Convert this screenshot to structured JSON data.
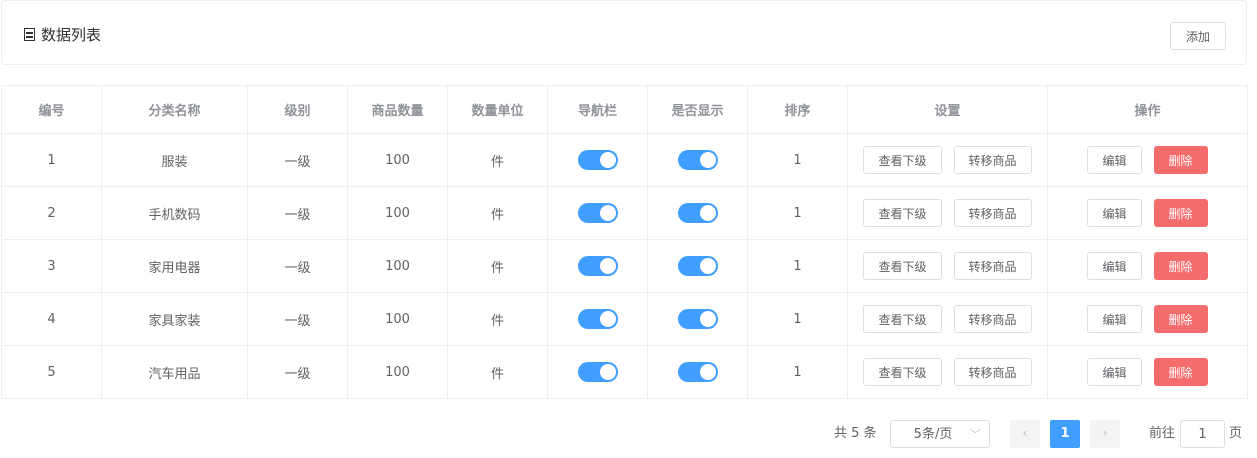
{
  "header": {
    "title": "数据列表",
    "add_label": "添加"
  },
  "table": {
    "columns": [
      "编号",
      "分类名称",
      "级别",
      "商品数量",
      "数量单位",
      "导航栏",
      "是否显示",
      "排序",
      "设置",
      "操作"
    ],
    "rows": [
      {
        "id": "1",
        "name": "服装",
        "level": "一级",
        "count": "100",
        "unit": "件",
        "nav": true,
        "show": true,
        "sort": "1"
      },
      {
        "id": "2",
        "name": "手机数码",
        "level": "一级",
        "count": "100",
        "unit": "件",
        "nav": true,
        "show": true,
        "sort": "1"
      },
      {
        "id": "3",
        "name": "家用电器",
        "level": "一级",
        "count": "100",
        "unit": "件",
        "nav": true,
        "show": true,
        "sort": "1"
      },
      {
        "id": "4",
        "name": "家具家装",
        "level": "一级",
        "count": "100",
        "unit": "件",
        "nav": true,
        "show": true,
        "sort": "1"
      },
      {
        "id": "5",
        "name": "汽车用品",
        "level": "一级",
        "count": "100",
        "unit": "件",
        "nav": true,
        "show": true,
        "sort": "1"
      }
    ],
    "actions": {
      "view_children": "查看下级",
      "transfer": "转移商品",
      "edit": "编辑",
      "delete": "删除"
    }
  },
  "pagination": {
    "total": "共 5 条",
    "page_size": "5条/页",
    "current_page": "1",
    "goto_label": "前往",
    "goto_value": "1",
    "page_suffix": "页"
  },
  "colors": {
    "primary": "#409eff",
    "danger": "#f56c6c"
  }
}
